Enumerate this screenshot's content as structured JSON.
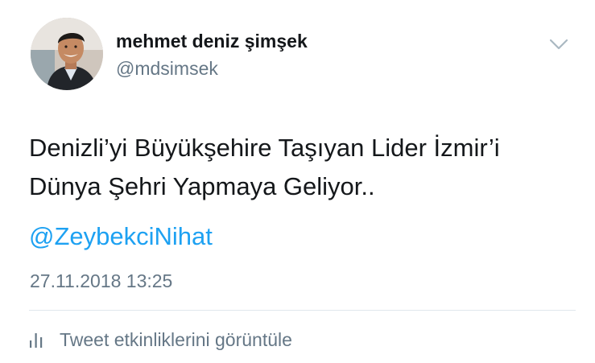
{
  "author": {
    "display_name": "mehmet deniz şimşek",
    "username": "@mdsimsek",
    "avatar_icon": "profile-photo"
  },
  "tweet": {
    "text_lines": [
      "Denizli’yi Büyükşehire Taşıyan Lider İzmir’i",
      "Dünya Şehri Yapmaya Geliyor.."
    ],
    "mention": "@ZeybekciNihat",
    "timestamp": "27.11.2018 13:25"
  },
  "actions": {
    "menu_icon": "chevron-down-icon",
    "activity_icon": "bar-chart-icon",
    "activity_label": "Tweet etkinliklerini görüntüle"
  },
  "colors": {
    "text_primary": "#14171a",
    "text_secondary": "#657786",
    "link": "#1da1f2",
    "divider": "#e1e8ed"
  }
}
